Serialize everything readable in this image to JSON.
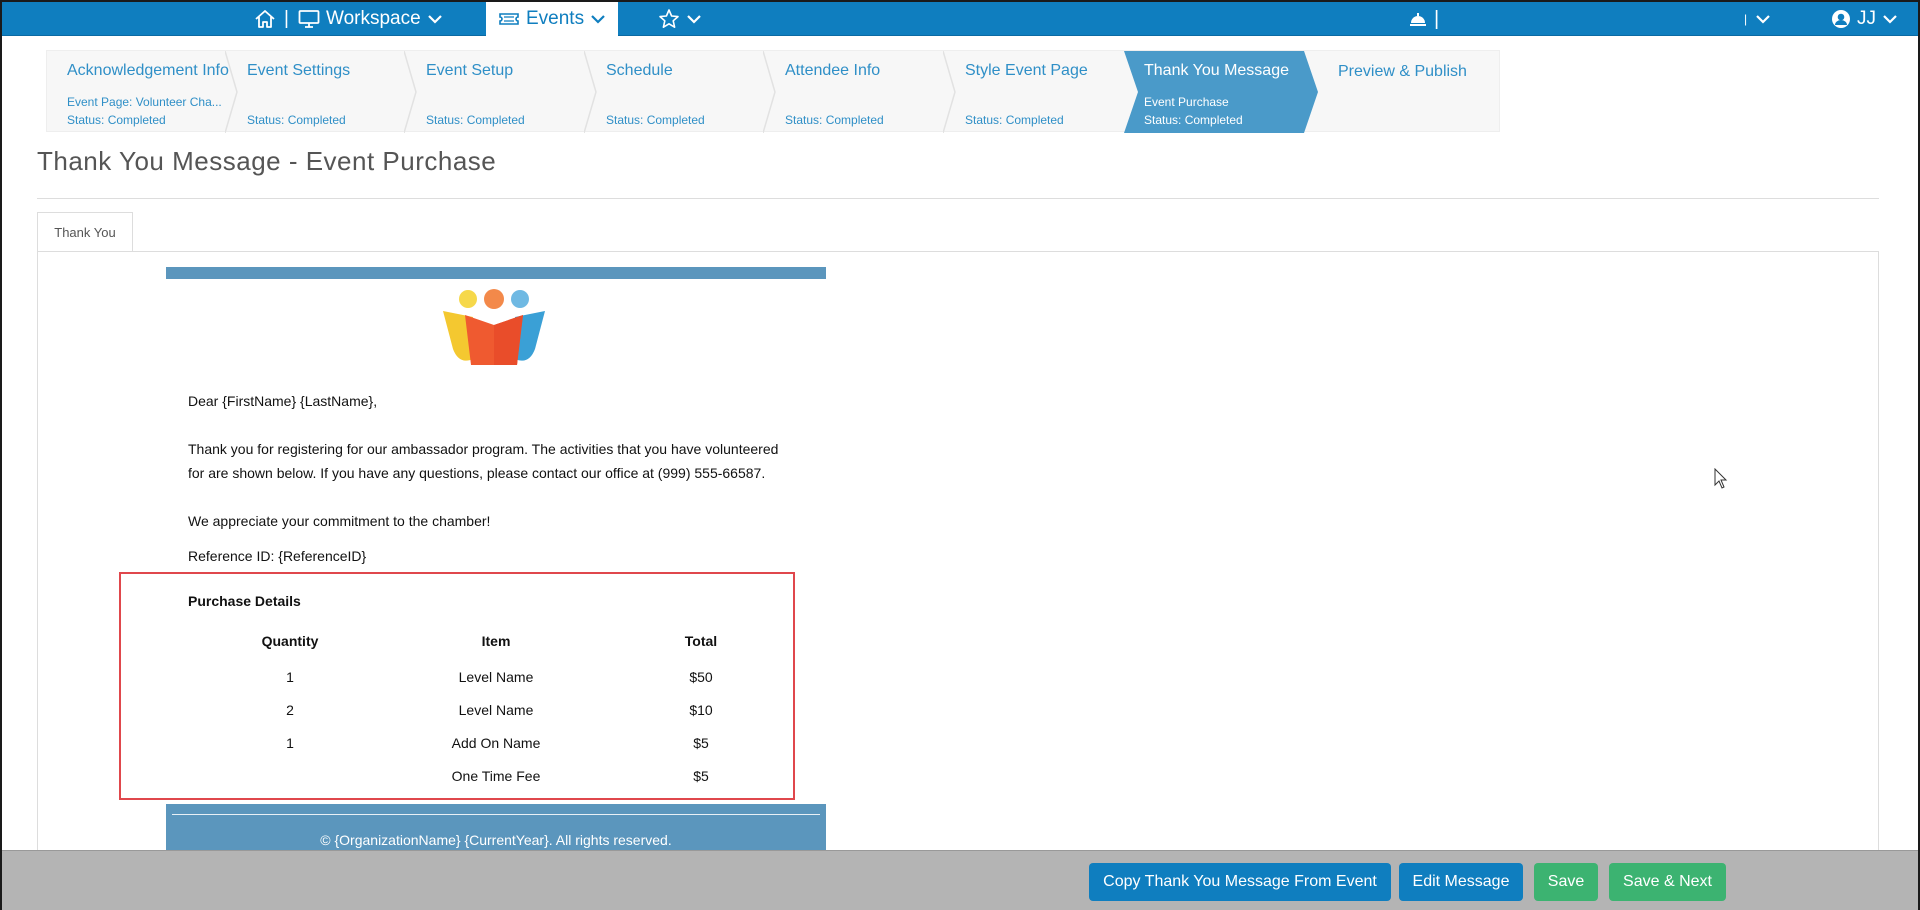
{
  "topnav": {
    "workspace_label": "Workspace",
    "events_label": "Events",
    "user_initials": "JJ"
  },
  "steps": [
    {
      "title": "Acknowledgement Info",
      "sub1": "Event Page: Volunteer Cha...",
      "sub2": "Status: Completed"
    },
    {
      "title": "Event Settings",
      "sub1": "",
      "sub2": "Status: Completed"
    },
    {
      "title": "Event Setup",
      "sub1": "",
      "sub2": "Status: Completed"
    },
    {
      "title": "Schedule",
      "sub1": "",
      "sub2": "Status: Completed"
    },
    {
      "title": "Attendee Info",
      "sub1": "",
      "sub2": "Status: Completed"
    },
    {
      "title": "Style Event Page",
      "sub1": "",
      "sub2": "Status: Completed"
    },
    {
      "title": "Thank You Message",
      "sub1": "Event Purchase",
      "sub2": "Status: Completed"
    },
    {
      "title": "Preview & Publish",
      "sub1": "",
      "sub2": ""
    }
  ],
  "page_title": "Thank You Message - Event Purchase",
  "tab_label": "Thank You",
  "email": {
    "greeting": "Dear {FirstName} {LastName},",
    "body_line1": "Thank you for registering for our ambassador program. The activities that you have volunteered",
    "body_line2": "for are shown below. If you have any questions, please contact our office at (999) 555-66587.",
    "appreciation": "We appreciate your commitment to the chamber!",
    "reference": "Reference ID: {ReferenceID}",
    "purchase_title": "Purchase Details",
    "columns": [
      "Quantity",
      "Item",
      "Total"
    ],
    "rows": [
      [
        "1",
        "Level Name",
        "$50"
      ],
      [
        "2",
        "Level Name",
        "$10"
      ],
      [
        "1",
        "Add On Name",
        "$5"
      ],
      [
        "",
        "One Time Fee",
        "$5"
      ]
    ],
    "footer": "© {OrganizationName} {CurrentYear}. All rights reserved."
  },
  "buttons": {
    "copy": "Copy Thank You Message From Event",
    "edit": "Edit Message",
    "save": "Save",
    "save_next": "Save & Next"
  },
  "colors": {
    "primary": "#0f7ebf",
    "step_active": "#4a9ac9",
    "email_band": "#5b96bd",
    "success": "#3cb371",
    "highlight_border": "#e0474c"
  }
}
